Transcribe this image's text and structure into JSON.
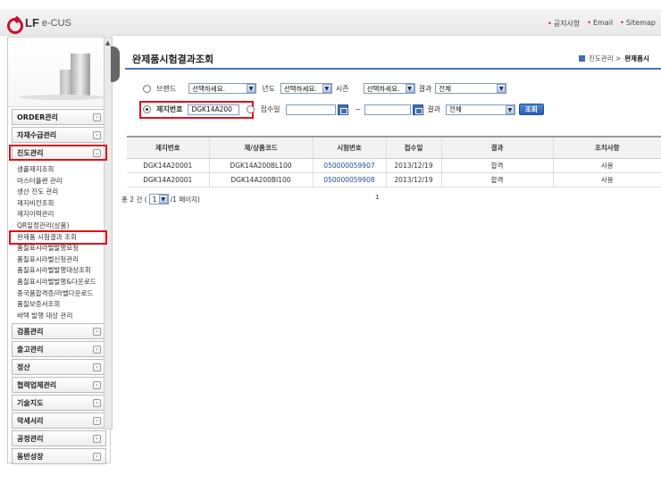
{
  "header": {
    "logo_lf": "LF",
    "logo_ecus": "e-CUS",
    "links": [
      "공지사항",
      "Email",
      "Sitemap"
    ]
  },
  "sidebar": {
    "menus": [
      {
        "label": "ORDER관리"
      },
      {
        "label": "자재수급관리"
      },
      {
        "label": "진도관리",
        "expanded": true
      }
    ],
    "sub_items": [
      "샘플재지조회",
      "마스터플랜 관리",
      "생산 진도 관리",
      "재지비전조회",
      "재지이력관리",
      "QR일정관리(상품)",
      "완제품 시험결과 조회",
      "품질표시라벨발행요청",
      "품질표시라벨신청관리",
      "품질표시라벨발행대상조회",
      "품질표시라벨발행&다운로드",
      "중국품합격증/라벨다운로드",
      "품질보증서조회",
      "바텍 발행 대상 관리"
    ],
    "menus_after": [
      {
        "label": "검품관리"
      },
      {
        "label": "출고관리"
      },
      {
        "label": "정산"
      },
      {
        "label": "협력업체관리"
      },
      {
        "label": "기술지도"
      },
      {
        "label": "악세서리"
      },
      {
        "label": "공정관리"
      },
      {
        "label": "동반성장"
      }
    ]
  },
  "page": {
    "title": "완제품시험결과조회",
    "breadcrumb_parent": "진도관리 >",
    "breadcrumb_current": "완제품시"
  },
  "filters": {
    "row1": {
      "brand_label": "브랜드",
      "brand_value": "선택하세요.",
      "year_label": "년도",
      "year_value": "선택하세요.",
      "season_label": "시즌",
      "season_value": "선택하세요.",
      "result_label": "결과",
      "result_value": "전체"
    },
    "row2": {
      "jeji_label": "제지번호",
      "jeji_value": "DGK14A200",
      "receipt_label": "접수일",
      "receipt_from": "",
      "tilde": "~",
      "receipt_to": "",
      "result_label": "결과",
      "result_value": "전체",
      "search_button": "조회"
    }
  },
  "table": {
    "headers": [
      "제지번호",
      "제/상품코드",
      "시험번호",
      "접수일",
      "결과",
      "조치사항"
    ],
    "rows": [
      [
        "DGK14A20001",
        "DGK14A200BL100",
        "050000059907",
        "2013/12/19",
        "합격",
        "사용"
      ],
      [
        "DGK14A20001",
        "DGK14A200BI100",
        "050000059908",
        "2013/12/19",
        "합격",
        "사용"
      ]
    ]
  },
  "paging": {
    "total_text": "총 2 건 (",
    "page_value": "1",
    "suffix_text": "/1 페이지)",
    "center_number": "1"
  }
}
